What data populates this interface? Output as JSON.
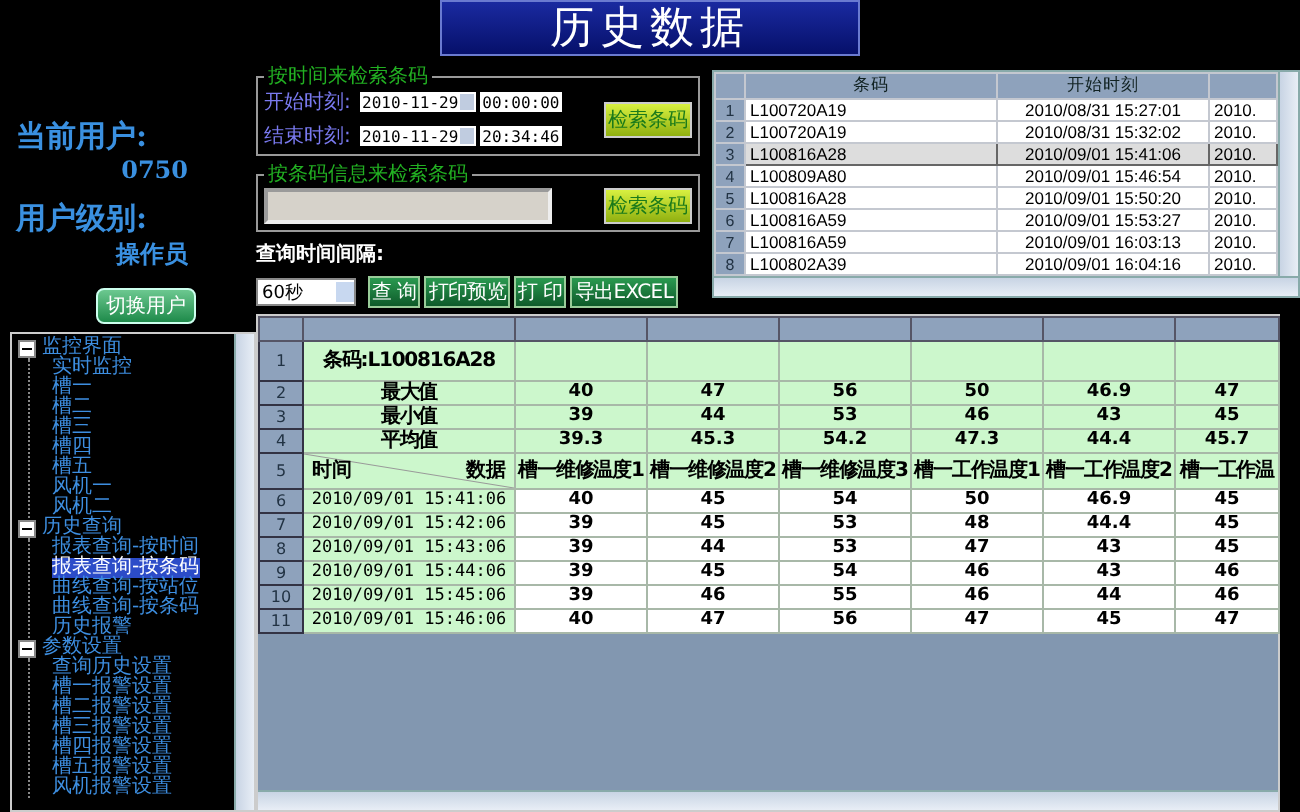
{
  "title": "历史数据",
  "user": {
    "current_label": "当前用户:",
    "current_value": "0750",
    "level_label": "用户级别:",
    "level_value": "操作员",
    "switch_button": "切换用户"
  },
  "tree": [
    {
      "label": "监控界面",
      "expanded": true,
      "children": [
        {
          "label": "实时监控",
          "selected": false
        },
        {
          "label": "槽一",
          "selected": false
        },
        {
          "label": "槽二",
          "selected": false
        },
        {
          "label": "槽三",
          "selected": false
        },
        {
          "label": "槽四",
          "selected": false
        },
        {
          "label": "槽五",
          "selected": false
        },
        {
          "label": "风机一",
          "selected": false
        },
        {
          "label": "风机二",
          "selected": false
        }
      ]
    },
    {
      "label": "历史查询",
      "expanded": true,
      "children": [
        {
          "label": "报表查询-按时间",
          "selected": false
        },
        {
          "label": "报表查询-按条码",
          "selected": true
        },
        {
          "label": "曲线查询-按站位",
          "selected": false
        },
        {
          "label": "曲线查询-按条码",
          "selected": false
        },
        {
          "label": "历史报警",
          "selected": false
        }
      ]
    },
    {
      "label": "参数设置",
      "expanded": true,
      "children": [
        {
          "label": "查询历史设置",
          "selected": false
        },
        {
          "label": "槽一报警设置",
          "selected": false
        },
        {
          "label": "槽二报警设置",
          "selected": false
        },
        {
          "label": "槽三报警设置",
          "selected": false
        },
        {
          "label": "槽四报警设置",
          "selected": false
        },
        {
          "label": "槽五报警设置",
          "selected": false
        },
        {
          "label": "风机报警设置",
          "selected": false
        }
      ]
    }
  ],
  "time_search": {
    "legend": "按时间来检索条码",
    "start_label": "开始时刻:",
    "start_date": "2010-11-29",
    "start_time": "00:00:00",
    "end_label": "结束时刻:",
    "end_date": "2010-11-29",
    "end_time": "20:34:46",
    "button": "检索条码"
  },
  "code_search": {
    "legend": "按条码信息来检索条码",
    "button": "检索条码"
  },
  "interval": {
    "label": "查询时间间隔:",
    "value": "60秒"
  },
  "actions": [
    "查 询",
    "打印预览",
    "打 印",
    "导出EXCEL"
  ],
  "barcode_list": {
    "columns": [
      "条码",
      "开始时刻"
    ],
    "rows": [
      {
        "index": "1",
        "code": "L100720A19",
        "start": "2010/08/31 15:27:01",
        "column_3": "2010.",
        "selected": false
      },
      {
        "index": "2",
        "code": "L100720A19",
        "start": "2010/08/31 15:32:02",
        "column_3": "2010.",
        "selected": false
      },
      {
        "index": "3",
        "code": "L100816A28",
        "start": "2010/09/01 15:41:06",
        "column_3": "2010.",
        "selected": true
      },
      {
        "index": "4",
        "code": "L100809A80",
        "start": "2010/09/01 15:46:54",
        "column_3": "2010.",
        "selected": false
      },
      {
        "index": "5",
        "code": "L100816A28",
        "start": "2010/09/01 15:50:20",
        "column_3": "2010.",
        "selected": false
      },
      {
        "index": "6",
        "code": "L100816A59",
        "start": "2010/09/01 15:53:27",
        "column_3": "2010.",
        "selected": false
      },
      {
        "index": "7",
        "code": "L100816A59",
        "start": "2010/09/01 16:03:13",
        "column_3": "2010.",
        "selected": false
      },
      {
        "index": "8",
        "code": "L100802A39",
        "start": "2010/09/01 16:04:16",
        "column_3": "2010.",
        "selected": false
      }
    ]
  },
  "report": {
    "barcode_index": "1",
    "barcode": "条码:L100816A28",
    "summary": [
      {
        "index": "2",
        "label": "最大值",
        "values": [
          "40",
          "47",
          "56",
          "50",
          "46.9",
          "47"
        ]
      },
      {
        "index": "3",
        "label": "最小值",
        "values": [
          "39",
          "44",
          "53",
          "46",
          "43",
          "45"
        ]
      },
      {
        "index": "4",
        "label": "平均值",
        "values": [
          "39.3",
          "45.3",
          "54.2",
          "47.3",
          "44.4",
          "45.7"
        ]
      }
    ],
    "header_index": "5",
    "time_label": "时间",
    "data_label": "数据",
    "columns": [
      "槽一维修温度1",
      "槽一维修温度2",
      "槽一维修温度3",
      "槽一工作温度1",
      "槽一工作温度2",
      "槽一工作温"
    ],
    "rows": [
      {
        "index": "6",
        "time": "2010/09/01 15:41:06",
        "values": [
          "40",
          "45",
          "54",
          "50",
          "46.9",
          "45"
        ]
      },
      {
        "index": "7",
        "time": "2010/09/01 15:42:06",
        "values": [
          "39",
          "45",
          "53",
          "48",
          "44.4",
          "45"
        ]
      },
      {
        "index": "8",
        "time": "2010/09/01 15:43:06",
        "values": [
          "39",
          "44",
          "53",
          "47",
          "43",
          "45"
        ]
      },
      {
        "index": "9",
        "time": "2010/09/01 15:44:06",
        "values": [
          "39",
          "45",
          "54",
          "46",
          "43",
          "46"
        ]
      },
      {
        "index": "10",
        "time": "2010/09/01 15:45:06",
        "values": [
          "39",
          "46",
          "55",
          "46",
          "44",
          "46"
        ]
      },
      {
        "index": "11",
        "time": "2010/09/01 15:46:06",
        "values": [
          "40",
          "47",
          "56",
          "47",
          "45",
          "47"
        ]
      }
    ]
  }
}
